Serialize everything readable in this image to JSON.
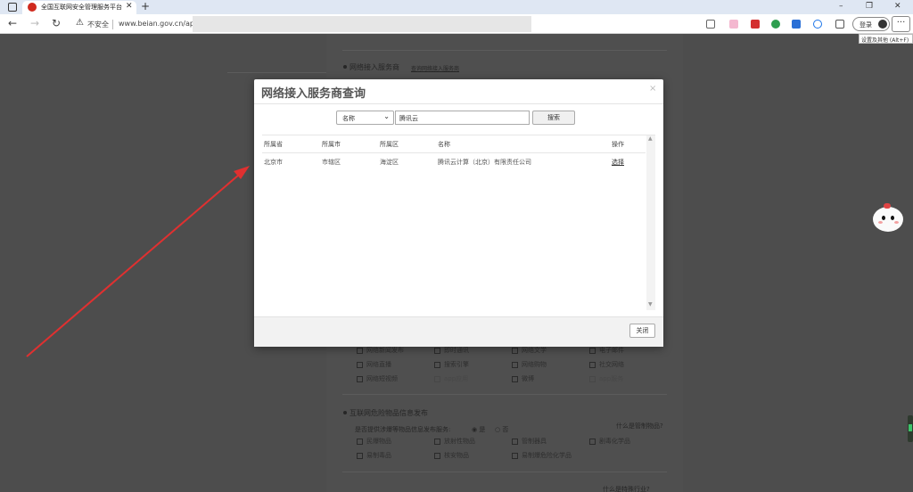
{
  "browser": {
    "tab_title": "全国互联网安全管理服务平台",
    "tab_close": "✕",
    "new_tab": "+",
    "security_label": "不安全",
    "url": "www.beian.gov.cn/apply/i",
    "login_label": "登录",
    "more_label": "···",
    "tooltip": "设置及其他 (Alt+F)"
  },
  "page": {
    "section_isp": "网络接入服务商",
    "section_isp_link": "查询网络接入服务商",
    "checkbox_rows_top": [
      [
        "网络新闻发布",
        "即时通讯",
        "网络文学",
        "电子邮件"
      ],
      [
        "网络直播",
        "搜索引擎",
        "网络购物",
        "社交网络"
      ],
      [
        "网络短视频",
        "app应用",
        "微博",
        "app服务"
      ]
    ],
    "section_goods": "互联网危险物品信息发布",
    "goods_question": "是否提供涉爆等物品信息发布服务:",
    "goods_yes": "是",
    "goods_no": "否",
    "goods_help": "什么是管制物品?",
    "checkbox_rows_goods": [
      [
        "民爆物品",
        "放射性物品",
        "管制器具",
        "剧毒化学品"
      ],
      [
        "易制毒品",
        "核安物品",
        "易制爆危险化学品"
      ]
    ],
    "bottom_help": "什么是特殊行业?"
  },
  "modal": {
    "title": "网络接入服务商查询",
    "close_x": "×",
    "search_field": "名称",
    "search_value": "腾讯云",
    "search_button": "搜索",
    "columns": [
      "所属省",
      "所属市",
      "所属区",
      "名称",
      "操作"
    ],
    "rows": [
      [
        "北京市",
        "市辖区",
        "海淀区",
        "腾讯云计算（北京）有限责任公司",
        "选择"
      ]
    ],
    "footer_close": "关闭"
  },
  "colors": {
    "annotation_arrow": "#e03030",
    "accent": "#1a73e8"
  }
}
